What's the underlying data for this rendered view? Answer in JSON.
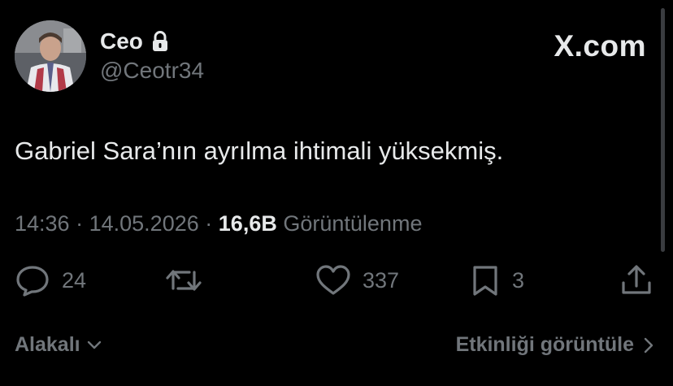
{
  "author": {
    "display_name": "Ceo",
    "handle": "@Ceotr34",
    "verified_icon": "lock-icon",
    "avatar": "avatar-photo"
  },
  "brand": {
    "label": "X.com"
  },
  "tweet": {
    "text": "Gabriel Sara’nın ayrılma ihtimali yüksekmiş."
  },
  "meta": {
    "time": "14:36",
    "separator": "·",
    "date": "14.05.2026",
    "views_count": "16,6B",
    "views_label": "Görüntülenme"
  },
  "actions": {
    "reply": {
      "icon": "reply-icon",
      "count": "24"
    },
    "retweet": {
      "icon": "retweet-icon",
      "count": ""
    },
    "like": {
      "icon": "heart-icon",
      "count": "337"
    },
    "bookmark": {
      "icon": "bookmark-icon",
      "count": "3"
    },
    "share": {
      "icon": "share-icon"
    }
  },
  "footer": {
    "sort_label": "Alakalı",
    "activity_label": "Etkinliği görüntüle"
  },
  "colors": {
    "background": "#000000",
    "primary_text": "#e7e9ea",
    "secondary_text": "#71767b"
  }
}
